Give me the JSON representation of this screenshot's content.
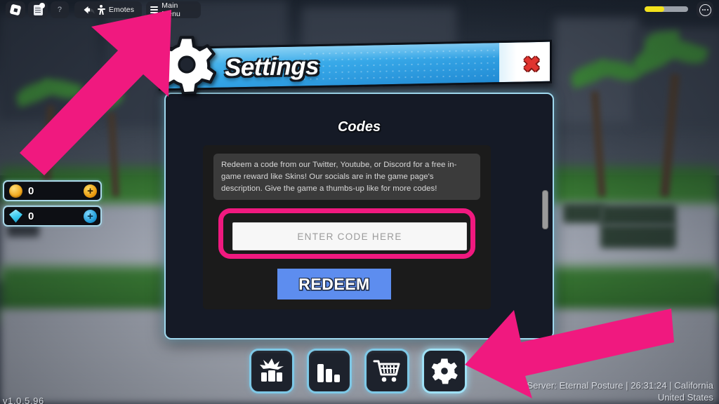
{
  "topbar": {
    "roblox_icon": "roblox-logo-icon",
    "capture_icon": "capture-screenshot-icon",
    "help_label": "?",
    "back_icon": "back-arrow-icon",
    "emotes_label": "Emotes",
    "emotes_icon": "person-dancing-icon",
    "main_menu_label": "Main Menu",
    "main_menu_icon": "hamburger-menu-icon",
    "health_percent": 45,
    "more_icon": "more-options-icon"
  },
  "currency": [
    {
      "name": "coins",
      "icon": "gold-coin-icon",
      "value": "0",
      "plus_label": "+"
    },
    {
      "name": "gems",
      "icon": "cyan-gem-icon",
      "value": "0",
      "plus_label": "+"
    }
  ],
  "panel": {
    "title": "Settings",
    "gear_icon": "gear-icon",
    "close_icon": "close-x-icon",
    "section_title": "Codes",
    "description": "Redeem a code from our Twitter, Youtube, or Discord for a free in-game reward like Skins! Our socials are in the game page's description. Give the game a thumbs-up like for more codes!",
    "code_placeholder": "ENTER CODE HERE",
    "code_value": "",
    "redeem_label": "REDEEM"
  },
  "bottom_nav": [
    {
      "name": "character",
      "icon": "character-avatar-icon",
      "active": false
    },
    {
      "name": "stats",
      "icon": "bar-chart-stats-icon",
      "active": false
    },
    {
      "name": "shop",
      "icon": "shopping-cart-icon",
      "active": false
    },
    {
      "name": "settings",
      "icon": "gear-icon",
      "active": true
    }
  ],
  "footer": {
    "version": "v1.0.5.96",
    "server_line1": "Server: Eternal Posture | 26:31:24 | California",
    "server_line2": "United States"
  },
  "annotations": {
    "arrow1": "pink-arrow-pointing-to-main-menu",
    "arrow2": "pink-arrow-pointing-to-settings-button",
    "highlight_color": "#f0197f"
  },
  "colors": {
    "banner_blue": "#37a8e8",
    "panel_border": "#9fd8ee",
    "redeem_blue": "#5d8def",
    "pink": "#f0197f",
    "close_red": "#e0342f"
  }
}
